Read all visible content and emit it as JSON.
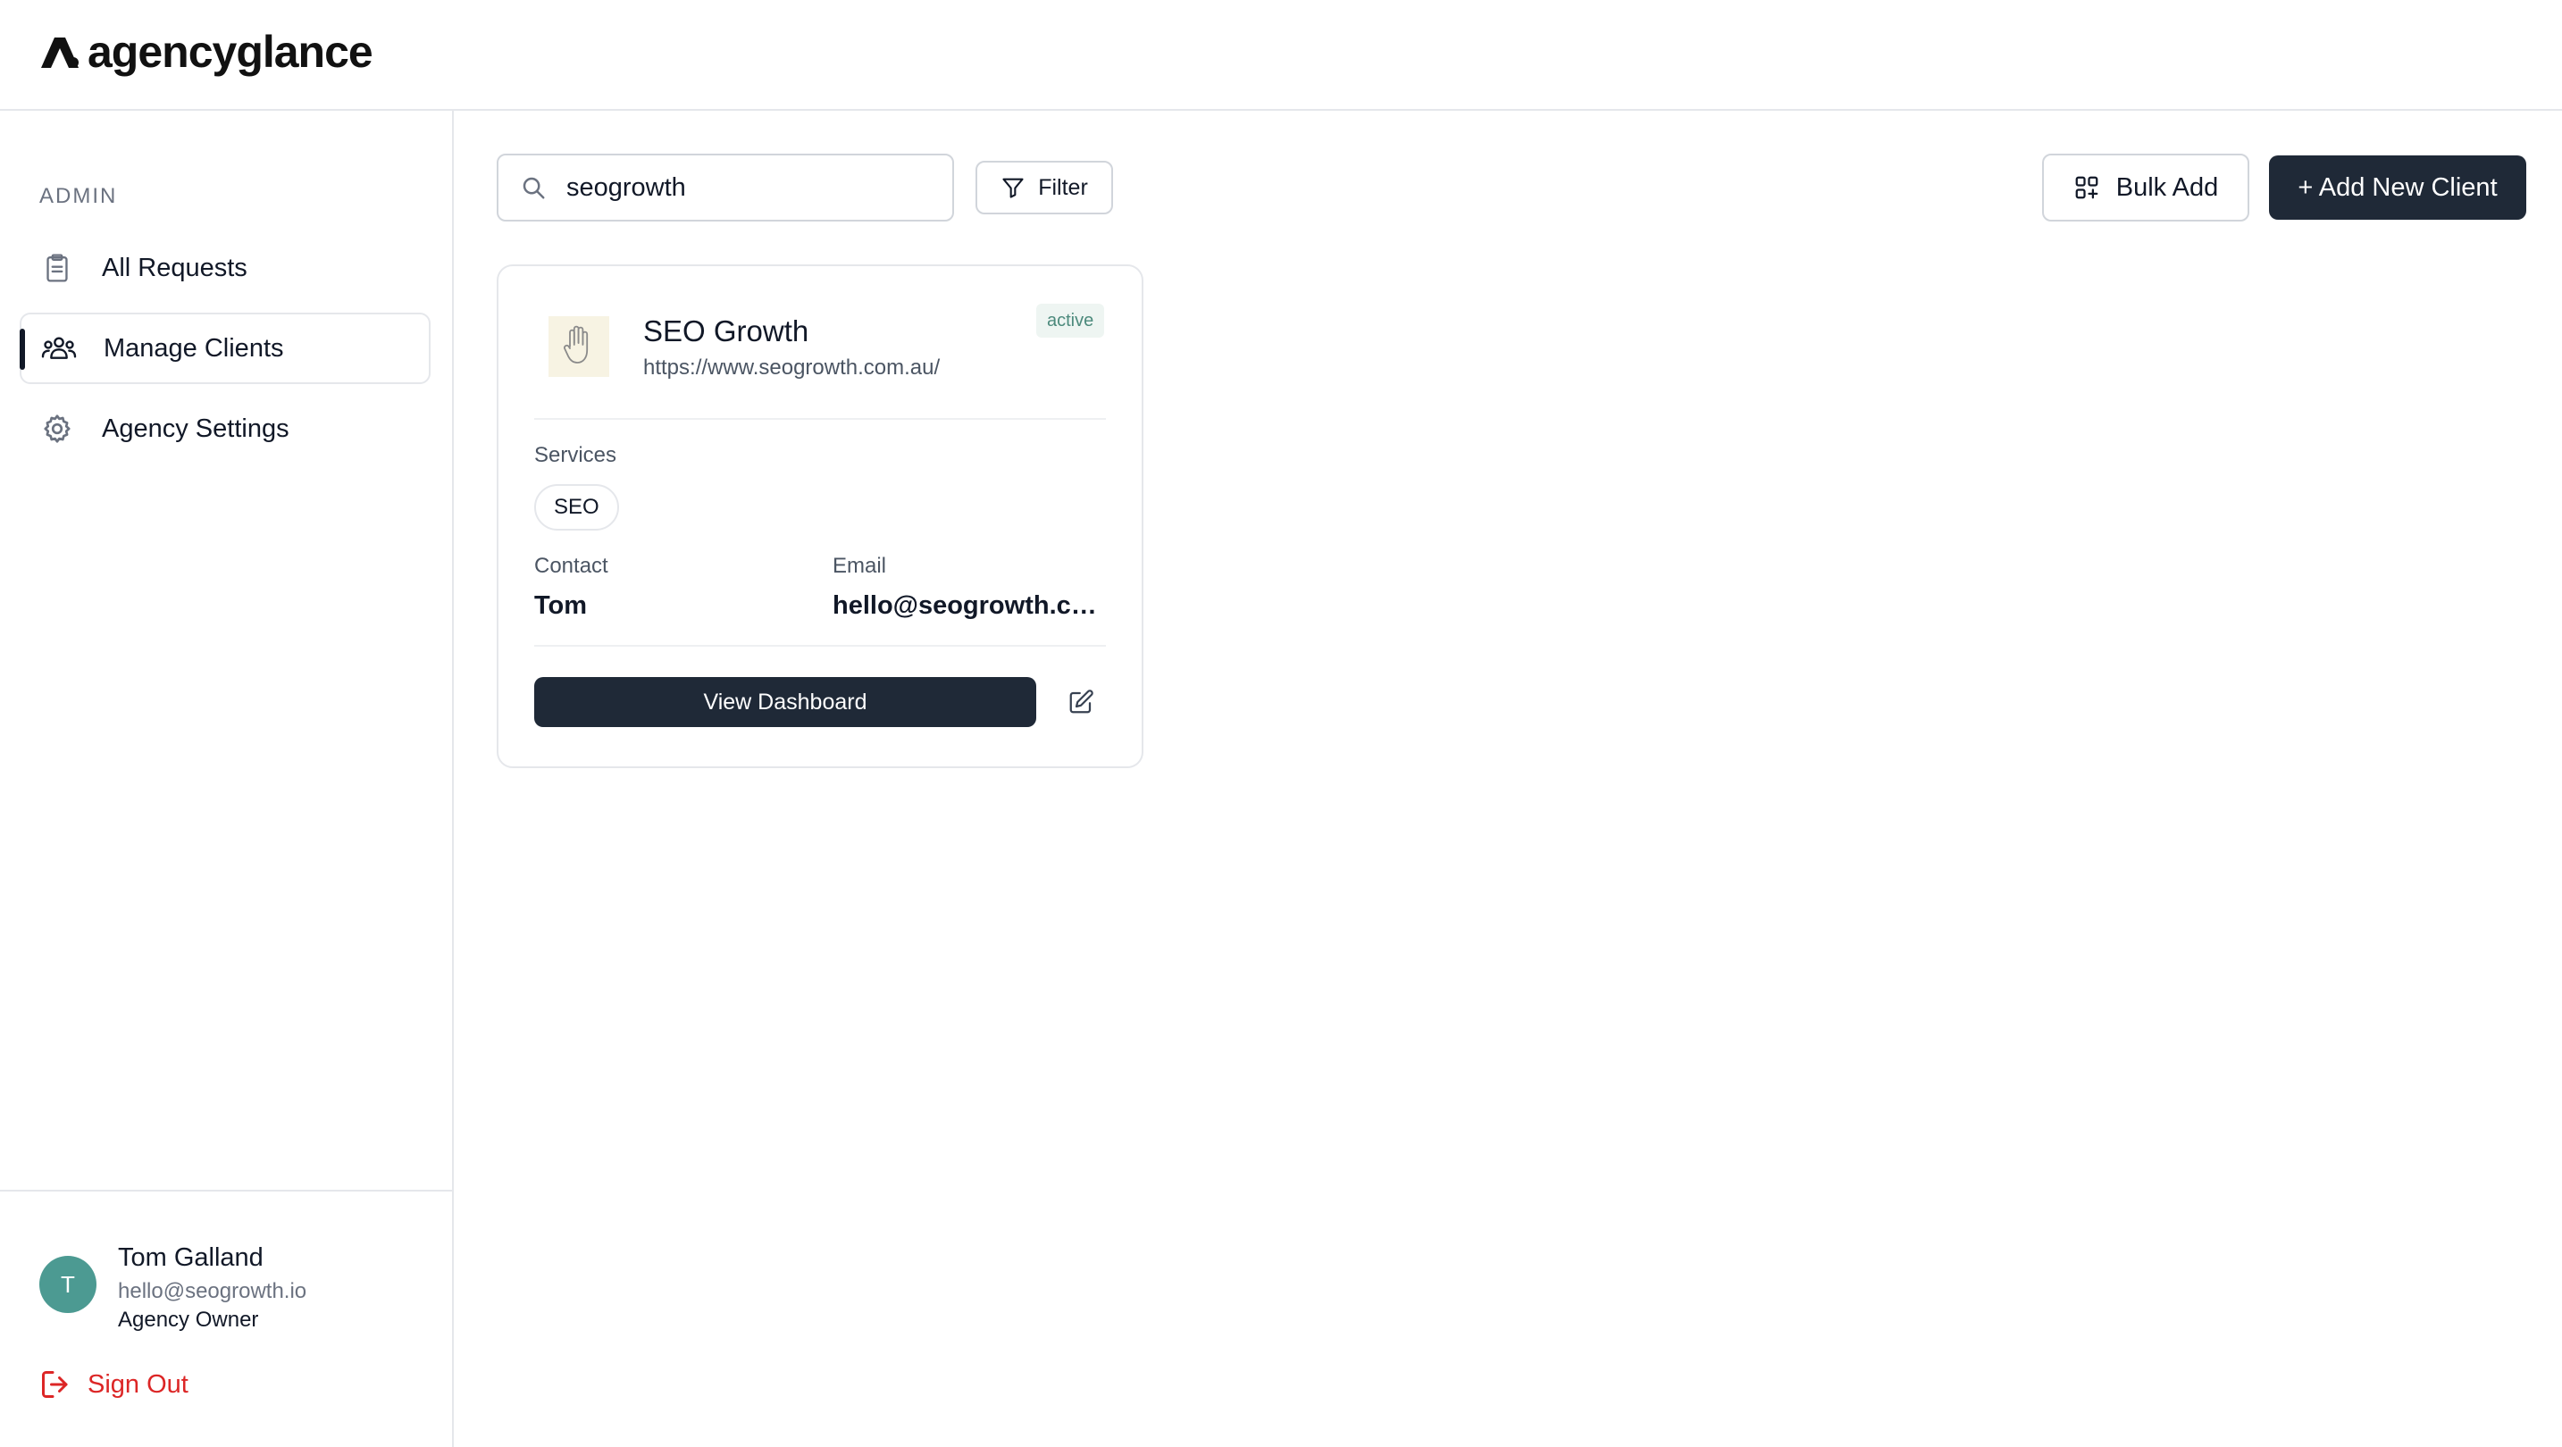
{
  "brand": {
    "name": "agencyglance"
  },
  "sidebar": {
    "section_label": "ADMIN",
    "items": [
      {
        "label": "All Requests",
        "icon": "clipboard-icon",
        "active": false
      },
      {
        "label": "Manage Clients",
        "icon": "users-icon",
        "active": true
      },
      {
        "label": "Agency Settings",
        "icon": "gear-icon",
        "active": false
      }
    ],
    "user": {
      "initial": "T",
      "name": "Tom Galland",
      "email": "hello@seogrowth.io",
      "role": "Agency Owner"
    },
    "sign_out_label": "Sign Out"
  },
  "toolbar": {
    "search_value": "seogrowth",
    "filter_label": "Filter",
    "bulk_add_label": "Bulk Add",
    "add_client_label": "+ Add New Client"
  },
  "clients": [
    {
      "name": "SEO Growth",
      "url": "https://www.seogrowth.com.au/",
      "status": "active",
      "services_label": "Services",
      "services": [
        "SEO"
      ],
      "contact_label": "Contact",
      "contact": "Tom",
      "email_label": "Email",
      "email": "hello@seogrowth.co...",
      "view_dashboard_label": "View Dashboard"
    }
  ],
  "colors": {
    "primary_dark": "#1f2937",
    "danger": "#dc2626",
    "avatar": "#4c9a92",
    "status_active_bg": "#eef5f2",
    "status_active_text": "#4c8a7c"
  }
}
